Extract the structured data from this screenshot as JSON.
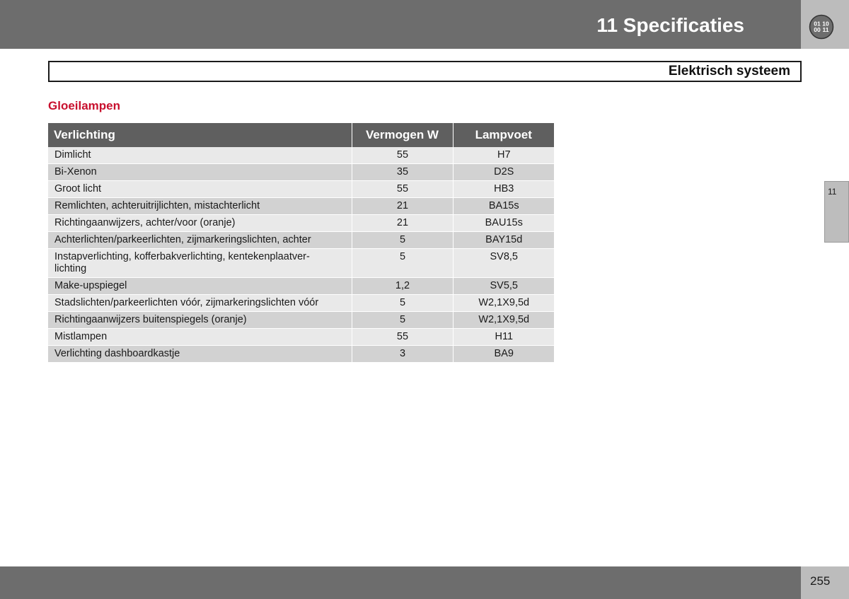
{
  "header": {
    "chapter_title": "11 Specificaties",
    "logo_digits": [
      "01",
      "10",
      "00",
      "11"
    ]
  },
  "section": {
    "title": "Elektrisch systeem"
  },
  "subheading": "Gloeilampen",
  "side_tab": {
    "label": "11"
  },
  "table": {
    "headers": [
      "Verlichting",
      "Vermogen W",
      "Lampvoet"
    ],
    "rows": [
      [
        "Dimlicht",
        "55",
        "H7"
      ],
      [
        "Bi-Xenon",
        "35",
        "D2S"
      ],
      [
        "Groot licht",
        "55",
        "HB3"
      ],
      [
        "Remlichten, achteruitrijlichten, mistachterlicht",
        "21",
        "BA15s"
      ],
      [
        "Richtingaanwijzers, achter/voor (oranje)",
        "21",
        "BAU15s"
      ],
      [
        "Achterlichten/parkeerlichten, zijmarkeringslichten, achter",
        "5",
        "BAY15d"
      ],
      [
        "Instapverlichting, kofferbakverlichting, kentekenplaatver-\nlichting",
        "5",
        "SV8,5"
      ],
      [
        "Make-upspiegel",
        "1,2",
        "SV5,5"
      ],
      [
        "Stadslichten/parkeerlichten vóór, zijmarkeringslichten vóór",
        "5",
        "W2,1X9,5d"
      ],
      [
        "Richtingaanwijzers buitenspiegels (oranje)",
        "5",
        "W2,1X9,5d"
      ],
      [
        "Mistlampen",
        "55",
        "H11"
      ],
      [
        "Verlichting dashboardkastje",
        "3",
        "BA9"
      ]
    ]
  },
  "footer": {
    "page_number": "255"
  },
  "colors": {
    "bar_gray": "#6d6d6d",
    "header_cell": "#5f5f5f",
    "row_light": "#e9e9e9",
    "row_dark": "#d2d2d2",
    "subheading_red": "#c8102e"
  }
}
